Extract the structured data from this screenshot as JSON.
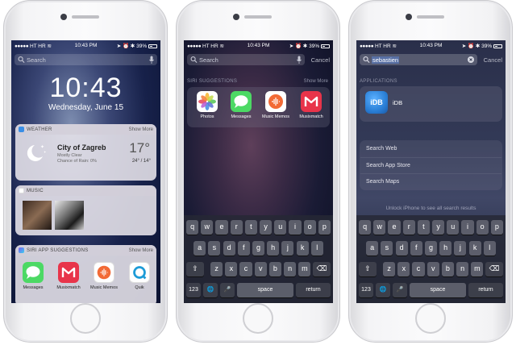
{
  "screen1": {
    "status": {
      "carrier": "HT HR",
      "time": "10:43 PM",
      "battery": "39%"
    },
    "search_placeholder": "Search",
    "lock_time": "10:43",
    "lock_date": "Wednesday, June 15",
    "weather": {
      "header": "WEATHER",
      "more": "Show More",
      "city": "City of Zagreb",
      "condition": "Mostly Clear",
      "rain": "Chance of Rain: 0%",
      "temp": "17°",
      "range": "24° / 14°"
    },
    "music": {
      "header": "MUSIC"
    },
    "siri": {
      "header": "SIRI APP SUGGESTIONS",
      "more": "Show More",
      "apps": [
        {
          "label": "Messages",
          "icon": "messages-icon"
        },
        {
          "label": "Musixmatch",
          "icon": "musixmatch-icon"
        },
        {
          "label": "Music Memos",
          "icon": "music-memos-icon"
        },
        {
          "label": "Quik",
          "icon": "quik-icon"
        }
      ]
    }
  },
  "screen2": {
    "status": {
      "carrier": "HT HR",
      "time": "10:43 PM",
      "battery": "39%"
    },
    "search_placeholder": "Search",
    "cancel": "Cancel",
    "siri_header": "SIRI SUGGESTIONS",
    "more": "Show More",
    "apps": [
      {
        "label": "Photos",
        "icon": "photos-icon"
      },
      {
        "label": "Messages",
        "icon": "messages-icon"
      },
      {
        "label": "Music Memos",
        "icon": "music-memos-icon"
      },
      {
        "label": "Musixmatch",
        "icon": "musixmatch-icon"
      }
    ]
  },
  "screen3": {
    "status": {
      "carrier": "HT HR",
      "time": "10:43 PM",
      "battery": "39%"
    },
    "search_value": "sebastien",
    "cancel": "Cancel",
    "applications_header": "APPLICATIONS",
    "result_app": {
      "label": "iDB",
      "icon_text": "iDB"
    },
    "suggestions": [
      "Search Web",
      "Search App Store",
      "Search Maps"
    ],
    "unlock_note": "Unlock iPhone to see all search results"
  },
  "keyboard": {
    "row1": [
      "q",
      "w",
      "e",
      "r",
      "t",
      "y",
      "u",
      "i",
      "o",
      "p"
    ],
    "row2": [
      "a",
      "s",
      "d",
      "f",
      "g",
      "h",
      "j",
      "k",
      "l"
    ],
    "row3": [
      "z",
      "x",
      "c",
      "v",
      "b",
      "n",
      "m"
    ],
    "num_key": "123",
    "space": "space",
    "return": "return"
  },
  "colors": {
    "messages": "#4cd964",
    "musixmatch": "#e8344a",
    "quik": "#1d9bd7",
    "idb": "#2a7fd6"
  }
}
